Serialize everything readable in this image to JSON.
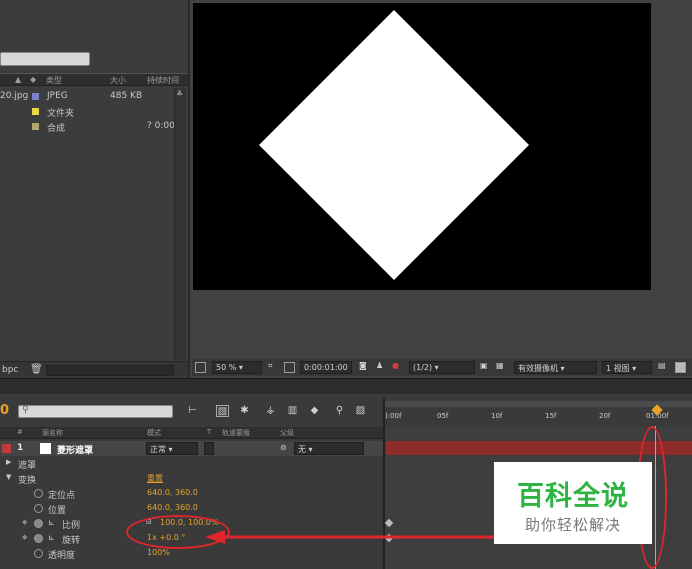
{
  "project": {
    "columns": [
      "类型",
      "大小",
      "持续时间"
    ],
    "items": [
      {
        "name": "20.jpg",
        "type": "JPEG",
        "size": "485 KB",
        "duration": "",
        "color": "#7f7fd0"
      },
      {
        "name": "",
        "type": "文件夹",
        "size": "",
        "duration": "",
        "color": "#e8d848"
      },
      {
        "name": "",
        "type": "合成",
        "size": "",
        "duration": "? 0:00",
        "color": "#b0a86c"
      }
    ],
    "footer_bpc": "bpc"
  },
  "viewer": {
    "zoom": "50 %",
    "timecode": "0:00:01:00",
    "resolution": "(1/2)",
    "camera": "有效摄像机",
    "views": "1 视图"
  },
  "timeline": {
    "time_display": "0",
    "header": {
      "num": "#",
      "source": "源名称",
      "mode": "模式",
      "t": "T",
      "trkmat": "轨道蒙版",
      "parent": "父级"
    },
    "layer": {
      "index": "1",
      "name": "菱形遮罩",
      "mode": "正常",
      "parent": "无"
    },
    "groups": {
      "masks": "遮罩",
      "transform": "变换",
      "reset": "重置"
    },
    "props": [
      {
        "name": "定位点",
        "value": "640.0, 360.0"
      },
      {
        "name": "位置",
        "value": "640.0, 360.0"
      },
      {
        "name": "比例",
        "value": "100.0, 100.0%"
      },
      {
        "name": "旋转",
        "value": "1x +0.0 °"
      },
      {
        "name": "透明度",
        "value": "100%"
      }
    ],
    "ruler_ticks": [
      "):00f",
      "05f",
      "10f",
      "15f",
      "20f",
      "01:00f"
    ]
  },
  "watermark": {
    "title": "百科全说",
    "subtitle": "助你轻松解决"
  },
  "colors": {
    "accent": "#e5a32a",
    "annotation": "#e0262b",
    "layer_bar": "#8e2c2c",
    "watermark_green": "#2fb344"
  }
}
